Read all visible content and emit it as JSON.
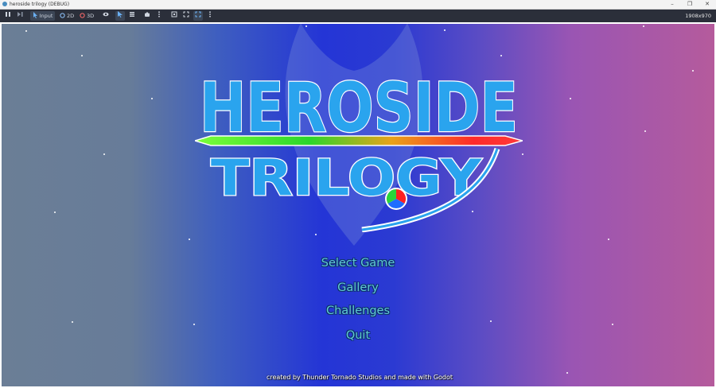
{
  "window": {
    "title": "heroside trilogy (DEBUG)",
    "minimize_glyph": "–",
    "restore_glyph": "❐",
    "close_glyph": "✕"
  },
  "toolbar": {
    "input_label": "Input",
    "2d_label": "2D",
    "3d_label": "3D",
    "resolution": "1908x970"
  },
  "logo": {
    "line1": "HEROSIDE",
    "line2": "TRILOGY"
  },
  "menu": {
    "items": [
      {
        "label": "Select Game"
      },
      {
        "label": "Gallery"
      },
      {
        "label": "Challenges"
      },
      {
        "label": "Quit"
      }
    ]
  },
  "footer": {
    "credits": "created by Thunder Tornado Studios  and made with Godot"
  },
  "colors": {
    "menu_text": "#5fc8d6",
    "logo_fill": "#2aa4ee",
    "bg_left": "#6b7e96",
    "bg_center": "#2435d6",
    "bg_right": "#b55b9c"
  }
}
